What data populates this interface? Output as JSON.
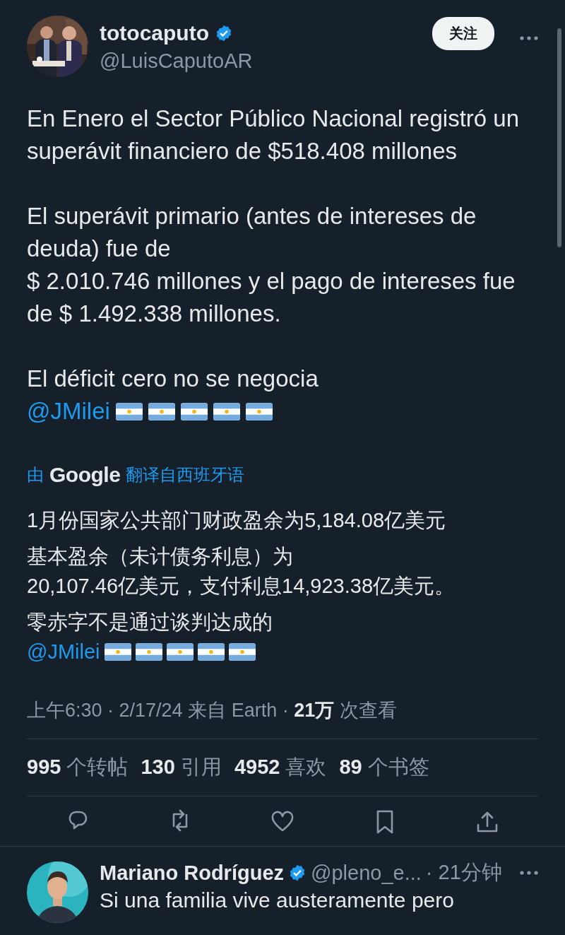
{
  "tweet": {
    "author": {
      "name": "totocaputo",
      "verified": true,
      "handle": "@LuisCaputoAR"
    },
    "follow_button": "关注",
    "paragraphs": [
      "En Enero el Sector Público Nacional registró un superávit financiero de $518.408 millones",
      "El superávit primario (antes de intereses de deuda) fue de\n$ 2.010.746 millones y el pago de intereses fue de $ 1.492.338 millones.",
      "El déficit cero no se negocia"
    ],
    "mention": "@JMilei",
    "translation": {
      "prefix": "由",
      "provider": "Google",
      "label": "翻译自西班牙语",
      "paragraphs": [
        "1月份国家公共部门财政盈余为5,184.08亿美元",
        "基本盈余（未计债务利息）为\n20,107.46亿美元，支付利息14,923.38亿美元。",
        "零赤字不是通过谈判达成的"
      ],
      "mention": "@JMilei"
    },
    "meta": {
      "info": "上午6:30 · 2/17/24 来自 Earth ·",
      "views": "21万",
      "views_label": "次查看"
    },
    "stats": [
      {
        "count": "995",
        "label": "个转帖"
      },
      {
        "count": "130",
        "label": "引用"
      },
      {
        "count": "4952",
        "label": "喜欢"
      },
      {
        "count": "89",
        "label": "个书签"
      }
    ],
    "actions": [
      {
        "kind": "reply"
      },
      {
        "kind": "repost"
      },
      {
        "kind": "like"
      },
      {
        "kind": "bookmark"
      },
      {
        "kind": "share"
      }
    ]
  },
  "reply": {
    "author": {
      "name": "Mariano Rodríguez",
      "verified": true,
      "handle": "@pleno_e...",
      "time": "· 21分钟"
    },
    "text": "Si una familia vive austeramente pero"
  }
}
